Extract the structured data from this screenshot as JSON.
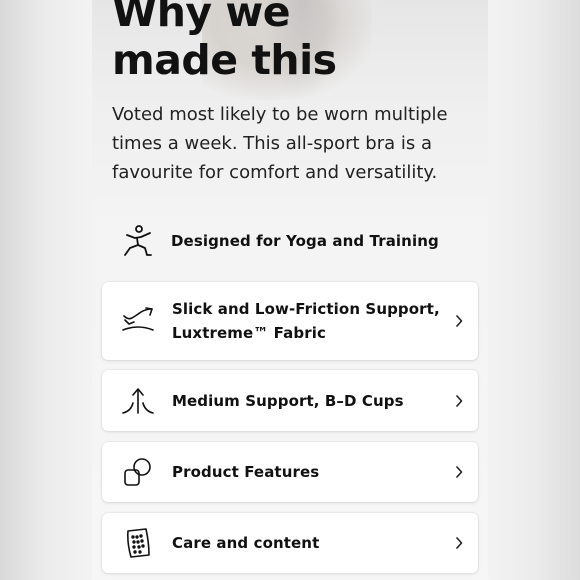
{
  "section": {
    "title": "Why we\nmade this",
    "description": "Voted most likely to be worn multiple times a week. This all-sport bra is a favourite for comfort and versatility."
  },
  "activity": {
    "label": "Designed for Yoga and Training",
    "icon": "yoga-pose-icon"
  },
  "features": [
    {
      "label": "Slick and Low-Friction Support, Luxtreme™ Fabric",
      "icon": "fabric-stretch-icon"
    },
    {
      "label": "Medium Support, B–D Cups",
      "icon": "support-level-icon"
    },
    {
      "label": "Product Features",
      "icon": "product-features-icon"
    },
    {
      "label": "Care and content",
      "icon": "care-label-icon"
    }
  ],
  "colors": {
    "text": "#111111",
    "card": "#ffffff",
    "background": "#f3f3f3"
  }
}
